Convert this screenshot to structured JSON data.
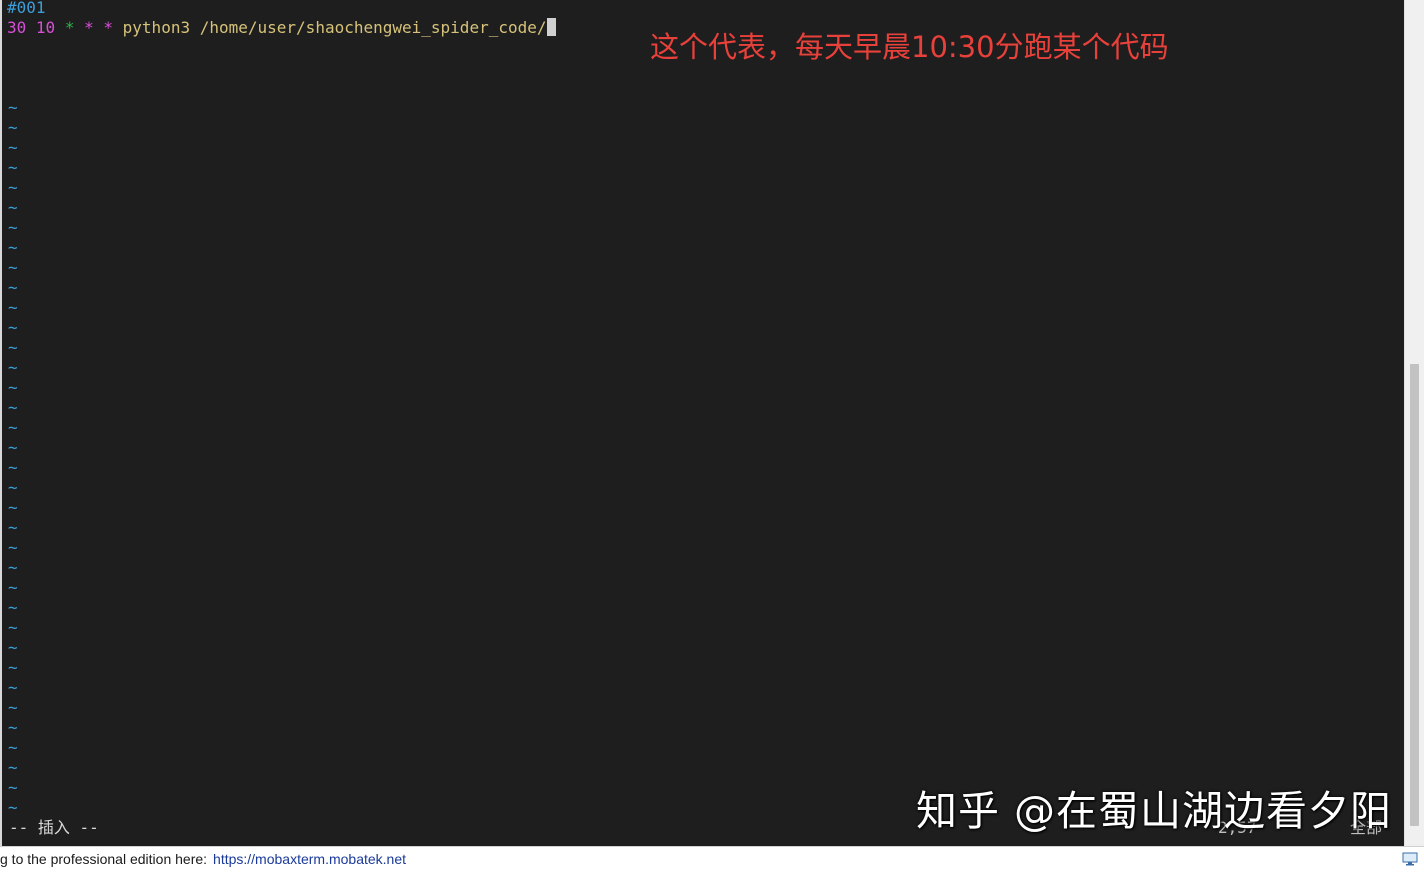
{
  "editor": {
    "line1": "#001",
    "line2": {
      "minute": "30",
      "hour": "10",
      "star1": "*",
      "star2": "*",
      "star3": "*",
      "command": "python3 /home/user/shaochengwei_spider_code/"
    },
    "tilde": "~",
    "mode_indicator": "-- 插入 --",
    "ruler_position": "2,57",
    "ruler_scope": "全部"
  },
  "annotation": {
    "text": "这个代表，每天早晨10:30分跑某个代码",
    "color": "#e8403a"
  },
  "watermark": {
    "text": "知乎 @在蜀山湖边看夕阳"
  },
  "statusbar": {
    "text": "g to the professional edition here:",
    "link_text": "https://mobaxterm.mobatek.net"
  },
  "icons": {
    "status_icon": "monitor-icon"
  },
  "colors": {
    "background": "#1e1e1e",
    "comment": "#3a9fd9",
    "number": "#d64fd6",
    "command": "#d6c27a",
    "star_green": "#2fb34a"
  }
}
